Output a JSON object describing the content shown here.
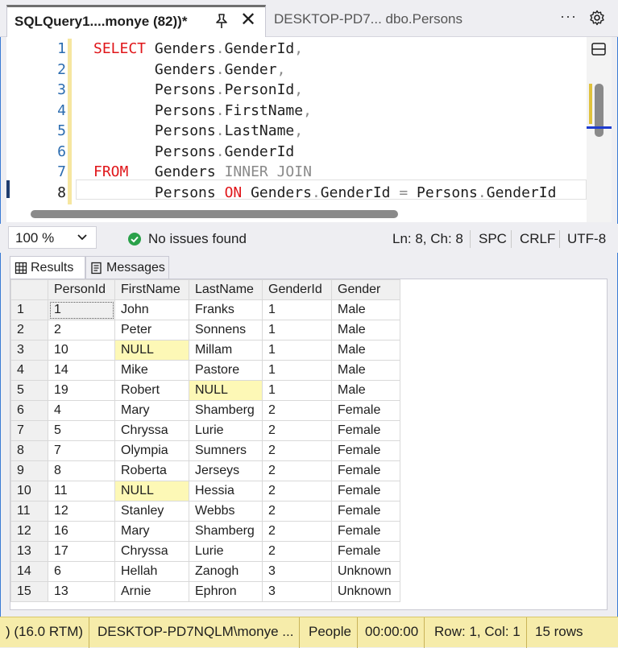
{
  "tabs": {
    "active_title": "SQLQuery1....monye (82))*",
    "inactive_title": "DESKTOP-PD7... dbo.Persons"
  },
  "editor": {
    "line_numbers": [
      "1",
      "2",
      "3",
      "4",
      "5",
      "6",
      "7",
      "8"
    ],
    "lines": [
      [
        {
          "t": "SELECT",
          "c": "kw"
        },
        {
          "t": " Genders"
        },
        {
          "t": ".",
          "c": "op"
        },
        {
          "t": "GenderId"
        },
        {
          "t": ",",
          "c": "op"
        }
      ],
      [
        {
          "t": "       Genders"
        },
        {
          "t": ".",
          "c": "op"
        },
        {
          "t": "Gender"
        },
        {
          "t": ",",
          "c": "op"
        }
      ],
      [
        {
          "t": "       Persons"
        },
        {
          "t": ".",
          "c": "op"
        },
        {
          "t": "PersonId"
        },
        {
          "t": ",",
          "c": "op"
        }
      ],
      [
        {
          "t": "       Persons"
        },
        {
          "t": ".",
          "c": "op"
        },
        {
          "t": "FirstName"
        },
        {
          "t": ",",
          "c": "op"
        }
      ],
      [
        {
          "t": "       Persons"
        },
        {
          "t": ".",
          "c": "op"
        },
        {
          "t": "LastName"
        },
        {
          "t": ",",
          "c": "op"
        }
      ],
      [
        {
          "t": "       Persons"
        },
        {
          "t": ".",
          "c": "op"
        },
        {
          "t": "GenderId"
        }
      ],
      [
        {
          "t": "FROM",
          "c": "kw"
        },
        {
          "t": "   Genders "
        },
        {
          "t": "INNER JOIN",
          "c": "op"
        }
      ],
      [
        {
          "t": "       Persons "
        },
        {
          "t": "ON",
          "c": "kw"
        },
        {
          "t": " Genders"
        },
        {
          "t": ".",
          "c": "op"
        },
        {
          "t": "GenderId "
        },
        {
          "t": "=",
          "c": "op"
        },
        {
          "t": " Persons"
        },
        {
          "t": ".",
          "c": "op"
        },
        {
          "t": "GenderId"
        }
      ]
    ]
  },
  "editor_status": {
    "zoom": "100 %",
    "issues": "No issues found",
    "position": "Ln: 8, Ch: 8",
    "spacing": "SPC",
    "line_ending": "CRLF",
    "encoding": "UTF-8"
  },
  "results_tabs": {
    "results": "Results",
    "messages": "Messages"
  },
  "grid": {
    "columns": [
      "PersonId",
      "FirstName",
      "LastName",
      "GenderId",
      "Gender"
    ],
    "rows": [
      [
        "1",
        "1",
        "John",
        "Franks",
        "1",
        "Male"
      ],
      [
        "2",
        "2",
        "Peter",
        "Sonnens",
        "1",
        "Male"
      ],
      [
        "3",
        "10",
        "NULL",
        "Millam",
        "1",
        "Male"
      ],
      [
        "4",
        "14",
        "Mike",
        "Pastore",
        "1",
        "Male"
      ],
      [
        "5",
        "19",
        "Robert",
        "NULL",
        "1",
        "Male"
      ],
      [
        "6",
        "4",
        "Mary",
        "Shamberg",
        "2",
        "Female"
      ],
      [
        "7",
        "5",
        "Chryssa",
        "Lurie",
        "2",
        "Female"
      ],
      [
        "8",
        "7",
        "Olympia",
        "Sumners",
        "2",
        "Female"
      ],
      [
        "9",
        "8",
        "Roberta",
        "Jerseys",
        "2",
        "Female"
      ],
      [
        "10",
        "11",
        "NULL",
        "Hessia",
        "2",
        "Female"
      ],
      [
        "11",
        "12",
        "Stanley",
        "Webbs",
        "2",
        "Female"
      ],
      [
        "12",
        "16",
        "Mary",
        "Shamberg",
        "2",
        "Female"
      ],
      [
        "13",
        "17",
        "Chryssa",
        "Lurie",
        "2",
        "Female"
      ],
      [
        "14",
        "6",
        "Hellah",
        "Zanogh",
        "3",
        "Unknown"
      ],
      [
        "15",
        "13",
        "Arnie",
        "Ephron",
        "3",
        "Unknown"
      ]
    ]
  },
  "status_bar": {
    "version": ") (16.0 RTM)",
    "server": "DESKTOP-PD7NQLM\\monye ...",
    "database": "People",
    "elapsed": "00:00:00",
    "rowcol": "Row: 1, Col: 1",
    "rows": "15 rows"
  },
  "colors": {
    "keyword": "#e0161a",
    "operator": "#8a8a8a",
    "line_number": "#2b6cb0",
    "null_cell": "#fdf8b6",
    "status_bar": "#f6ecaa",
    "success": "#2aa14a"
  }
}
